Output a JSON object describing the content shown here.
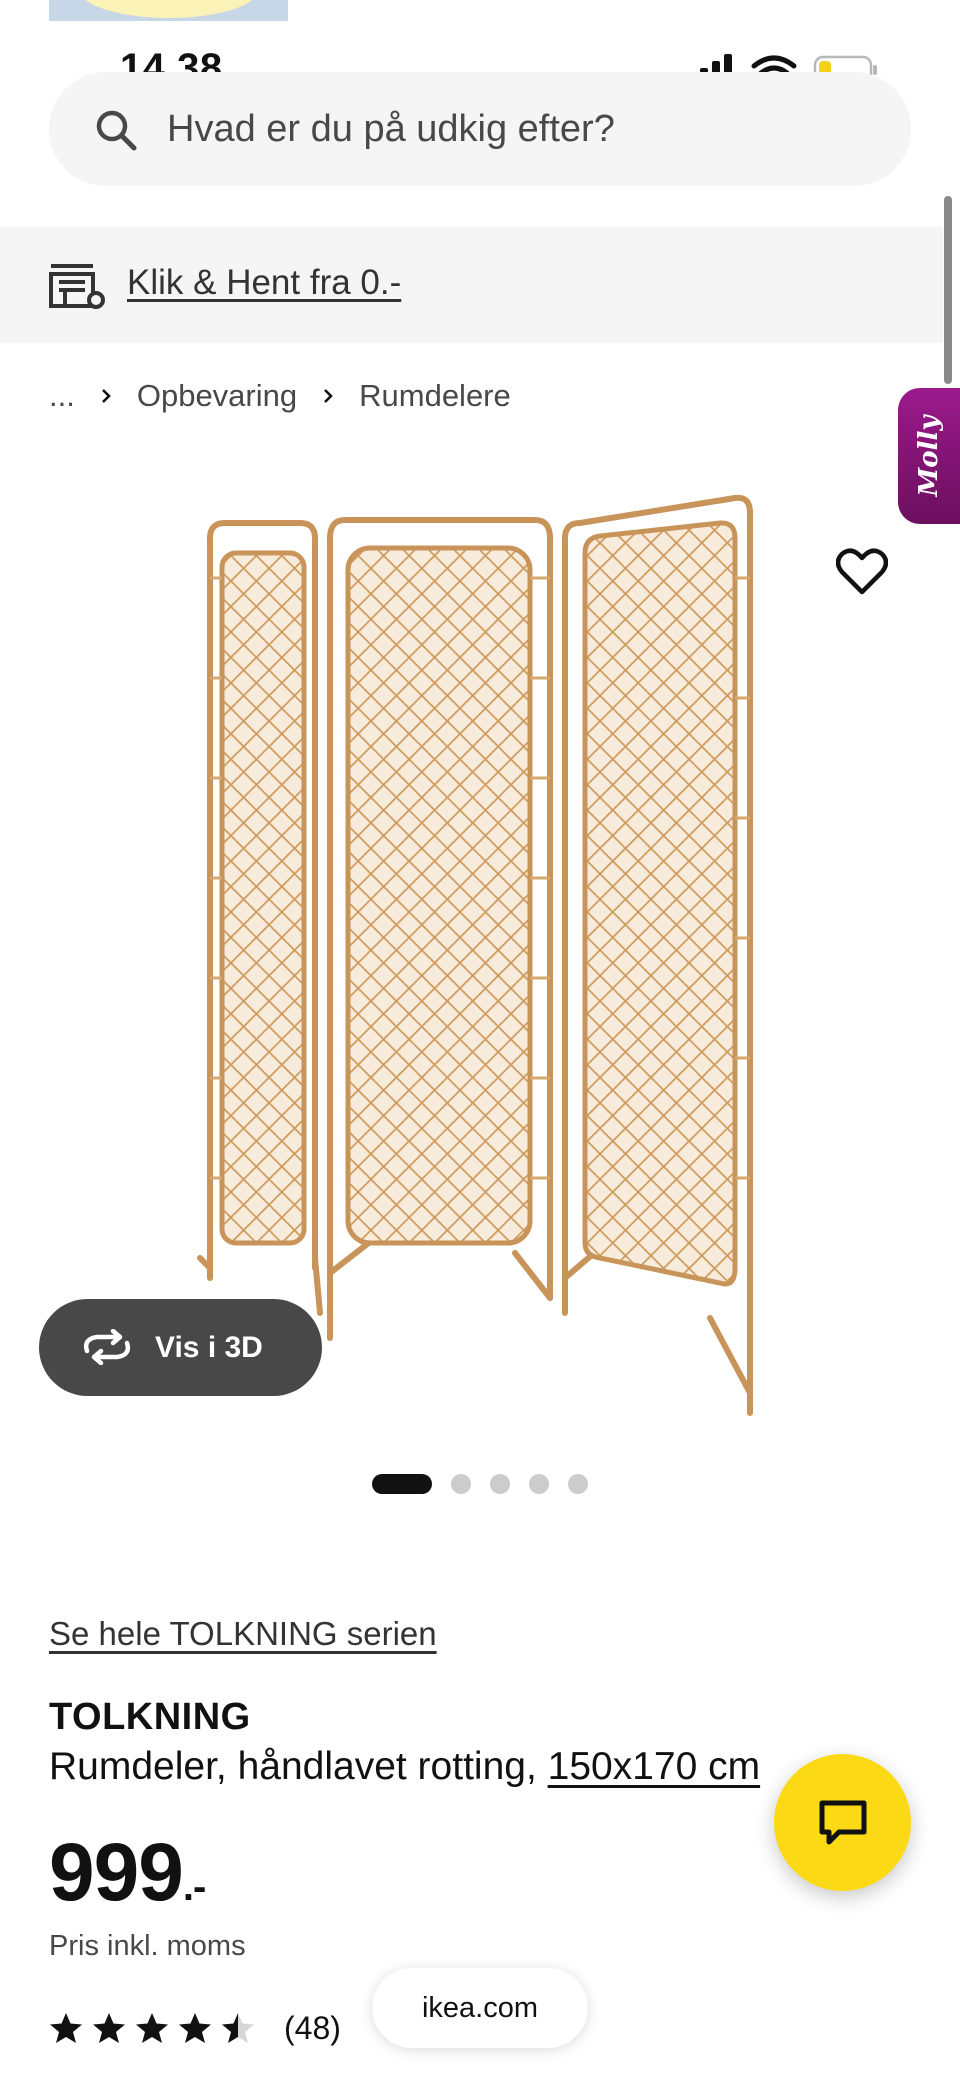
{
  "status_bar": {
    "time": "14.38"
  },
  "search": {
    "placeholder": "Hvad er du på udkig efter?"
  },
  "promo": {
    "link_text": "Klik & Hent fra 0.-"
  },
  "breadcrumb": {
    "items": [
      "...",
      "Opbevaring",
      "Rumdelere"
    ]
  },
  "assistant_tab": {
    "label": "Molly"
  },
  "gallery": {
    "view_3d_label": "Vis i 3D",
    "image_count": 5,
    "active_index": 0
  },
  "product": {
    "series_link": "Se hele TOLKNING serien",
    "name": "TOLKNING",
    "description": "Rumdeler, håndlavet rotting, ",
    "size": "150x170 cm",
    "price": "999",
    "price_suffix": ".-",
    "price_note": "Pris inkl. moms",
    "rating": 4.5,
    "review_count": "(48)"
  },
  "browser": {
    "domain": "ikea.com"
  },
  "colors": {
    "accent_yellow": "#fbd914",
    "dark_button": "#484848",
    "assistant_purple": "#8a1679",
    "rattan": "#d7a86e"
  },
  "icons": {
    "search": "search-icon",
    "store": "store-icon",
    "heart": "heart-icon",
    "rotate": "rotate-3d-icon",
    "chat": "chat-icon",
    "star": "star-icon"
  }
}
